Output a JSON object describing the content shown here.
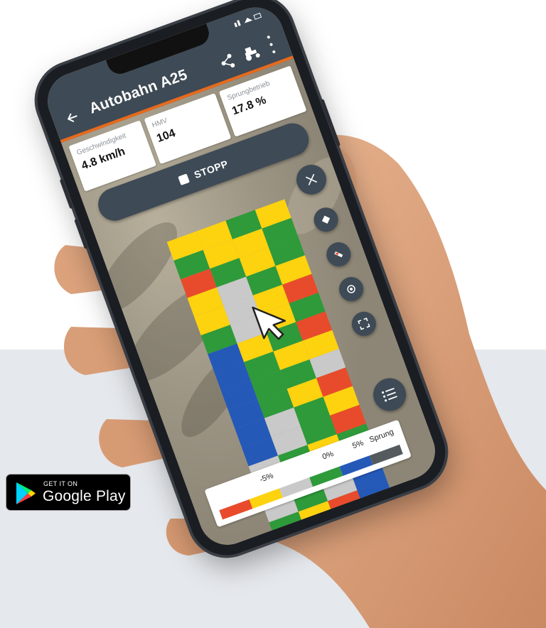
{
  "app": {
    "title": "Autobahn A25",
    "icons": [
      "back-arrow-icon",
      "share-icon",
      "tractor-icon",
      "more-vert-icon"
    ],
    "accent_color": "#e86a1c",
    "bar_color": "#3e4a55"
  },
  "stats": [
    {
      "label": "Geschwindigkeit",
      "value": "4.8 km/h"
    },
    {
      "label": "HMV",
      "value": "104"
    },
    {
      "label": "Sprungbetrieb",
      "value": "17.8 %"
    }
  ],
  "stop_button": {
    "label": "STOPP"
  },
  "map_controls": [
    "close-icon",
    "layers-icon",
    "compass-icon",
    "locate-icon",
    "fullscreen-icon",
    "list-icon"
  ],
  "legend": {
    "ticks": [
      "-5%",
      "0%",
      "5%",
      "Sprung"
    ],
    "colors": [
      "#e84b2b",
      "#fdd20f",
      "#c9c9c9",
      "#2e9a3a",
      "#2459b8",
      "#555a5e"
    ]
  },
  "store_badge": {
    "small_text": "GET IT ON",
    "store_name": "Google Play"
  }
}
